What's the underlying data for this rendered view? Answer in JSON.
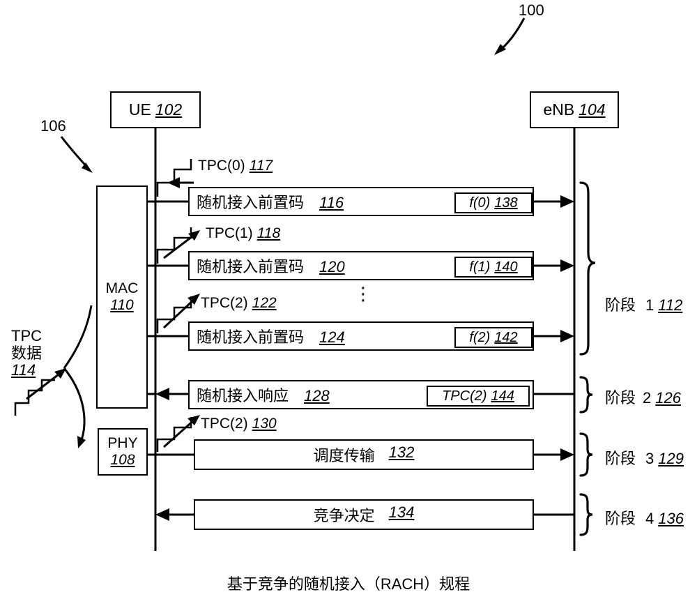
{
  "figure": {
    "number": "100",
    "caption": "基于竞争的随机接入（RACH）规程"
  },
  "nodes": {
    "ue": {
      "label": "UE",
      "num": "102"
    },
    "enb": {
      "label": "eNB",
      "num": "104"
    },
    "mac": {
      "label": "MAC",
      "num": "110"
    },
    "phy": {
      "label": "PHY",
      "num": "108"
    },
    "stack_ref": "106"
  },
  "tpc_data": {
    "line1": "TPC",
    "line2": "数据",
    "num": "114"
  },
  "tpc_labels": [
    {
      "text": "TPC(0)",
      "num": "117"
    },
    {
      "text": "TPC(1)",
      "num": "118"
    },
    {
      "text": "TPC(2)",
      "num": "122"
    },
    {
      "text": "TPC(2)",
      "num": "130"
    }
  ],
  "messages": [
    {
      "text": "随机接入前置码",
      "num": "116",
      "tag": "f(0)",
      "tag_num": "138",
      "dir": "right"
    },
    {
      "text": "随机接入前置码",
      "num": "120",
      "tag": "f(1)",
      "tag_num": "140",
      "dir": "right"
    },
    {
      "text": "随机接入前置码",
      "num": "124",
      "tag": "f(2)",
      "tag_num": "142",
      "dir": "right"
    },
    {
      "text": "随机接入响应",
      "num": "128",
      "tag": "TPC(2)",
      "tag_num": "144",
      "dir": "left"
    },
    {
      "text": "调度传输",
      "num": "132",
      "tag": "",
      "tag_num": "",
      "dir": "right"
    },
    {
      "text": "竞争决定",
      "num": "134",
      "tag": "",
      "tag_num": "",
      "dir": "left"
    }
  ],
  "ellipsis": "⋮",
  "phases": [
    {
      "label": "阶段",
      "index": "1",
      "num": "112"
    },
    {
      "label": "阶段",
      "index": "2",
      "num": "126"
    },
    {
      "label": "阶段",
      "index": "3",
      "num": "129"
    },
    {
      "label": "阶段",
      "index": "4",
      "num": "136"
    }
  ]
}
